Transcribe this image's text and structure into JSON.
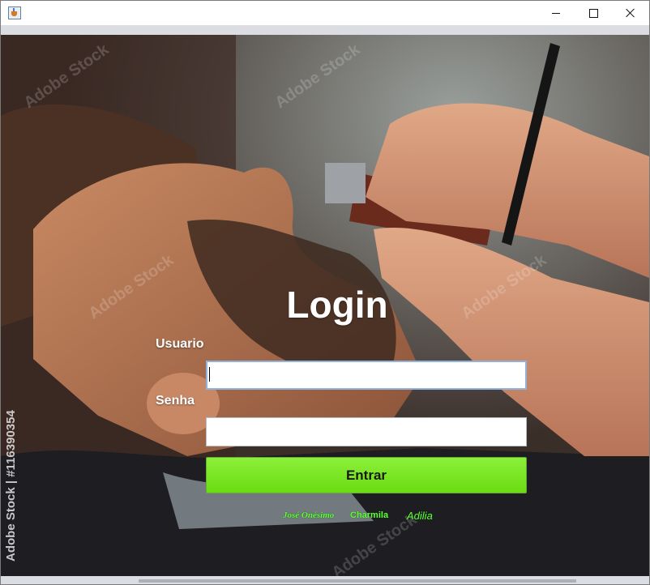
{
  "window": {
    "icon": "java-coffee-icon",
    "controls": {
      "minimize": "minimize-icon",
      "maximize": "maximize-icon",
      "close": "close-icon"
    }
  },
  "login": {
    "title": "Login",
    "user_label": "Usuario",
    "user_value": "",
    "password_label": "Senha",
    "password_value": "",
    "submit_label": "Entrar"
  },
  "credits": [
    "José Onésimo",
    "Charmila",
    "Adilia"
  ],
  "watermark": {
    "side_text": "Adobe Stock | #116390354",
    "brand": "Adobe Stock"
  },
  "colors": {
    "submit_button": "#7ce62a",
    "credits_text": "#5fff3a",
    "label_text": "#ffffff"
  }
}
